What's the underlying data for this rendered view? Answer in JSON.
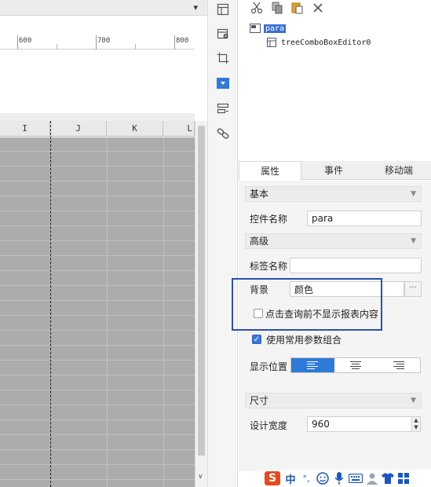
{
  "editor": {
    "ruler_labels": [
      "600",
      "700",
      "800"
    ],
    "columns": [
      "I",
      "J",
      "K",
      "L"
    ]
  },
  "tree": {
    "root_label": "para",
    "child_label": "treeComboBoxEditor0"
  },
  "tabs": [
    {
      "label": "属性",
      "active": true
    },
    {
      "label": "事件",
      "active": false
    },
    {
      "label": "移动端",
      "active": false
    }
  ],
  "props": {
    "basic_section": "基本",
    "control_name_label": "控件名称",
    "control_name_value": "para",
    "advanced_section": "高级",
    "tag_name_label": "标签名称",
    "tag_name_value": "",
    "background_label": "背景",
    "background_value": "颜色",
    "more_button": "···",
    "no_show_checkbox_label": "点击查询前不显示报表内容",
    "no_show_checked": false,
    "use_combo_checkbox_label": "使用常用参数组合",
    "use_combo_checked": true,
    "checkmark": "✓",
    "position_label": "显示位置",
    "align_options": [
      "left",
      "center",
      "right"
    ],
    "align_selected": "left",
    "size_section": "尺寸",
    "width_label": "设计宽度",
    "width_value": "960"
  },
  "ime": {
    "logo": "S",
    "mode": "中",
    "punct": "°,"
  },
  "colors": {
    "accent": "#2f7ad9",
    "highlight_box": "#2a4fb4",
    "grid_bg": "#acacac",
    "tree_selected": "#3a6fd0"
  }
}
